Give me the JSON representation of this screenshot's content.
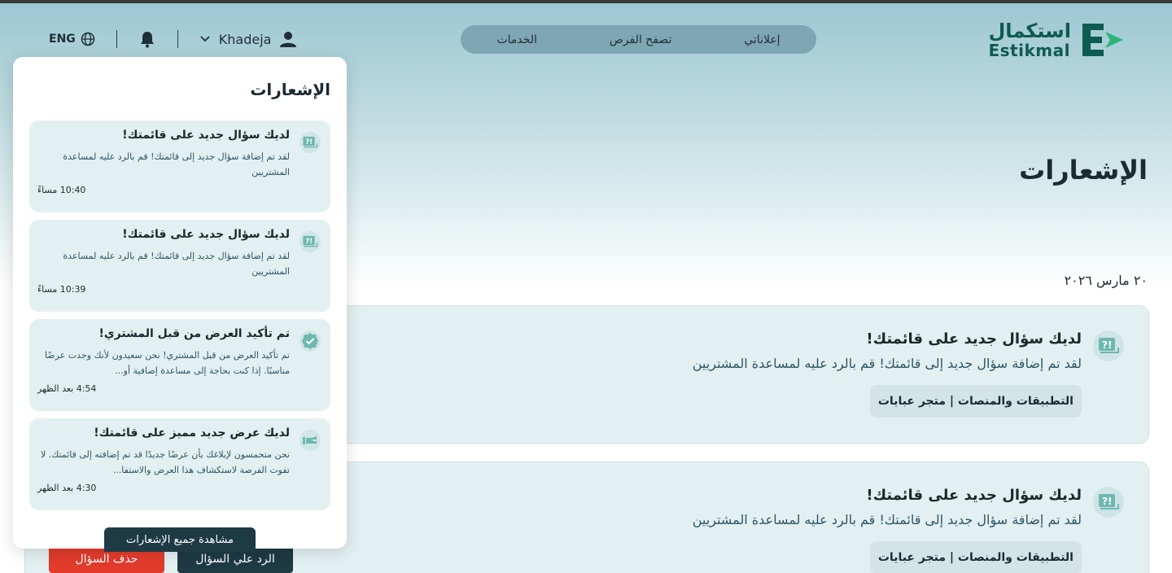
{
  "header": {
    "logo_ar": "استكمال",
    "logo_en": "Estikmal",
    "nav": [
      "إعلاناتي",
      "تصفح الفرص",
      "الخدمات"
    ],
    "lang": "ENG",
    "user_name": "Khadeja"
  },
  "page": {
    "title": "الإشعارات",
    "date": "٢٠ مارس ٢٠٢٦"
  },
  "cards": [
    {
      "title": "لديك سؤال جديد على قائمتك!",
      "desc": "لقد تم إضافة سؤال جديد إلى قائمتك! قم بالرد عليه لمساعدة المشتريين",
      "tag": "التطبيقات والمنصات | متجر عبايات"
    },
    {
      "title": "لديك سؤال جديد على قائمتك!",
      "desc": "لقد تم إضافة سؤال جديد إلى قائمتك! قم بالرد عليه لمساعدة المشتريين",
      "tag": "التطبيقات والمنصات | متجر عبايات"
    }
  ],
  "actions": {
    "reply": "الرد علي السؤال",
    "delete": "حذف السؤال"
  },
  "panel": {
    "title": "الإشعارات",
    "items": [
      {
        "icon": "question-icon",
        "title": "لديك سؤال جديد على قائمتك!",
        "desc": "لقد تم إضافة سؤال جديد إلى قائمتك! قم بالرد عليه لمساعدة المشتريين",
        "time": "10:40 مساءً"
      },
      {
        "icon": "question-icon",
        "title": "لديك سؤال جديد على قائمتك!",
        "desc": "لقد تم إضافة سؤال جديد إلى قائمتك! قم بالرد عليه لمساعدة المشتريين",
        "time": "10:39 مساءً"
      },
      {
        "icon": "verified-icon",
        "title": "تم تأكيد العرض من قبل المشتري!",
        "desc": "تم تأكيد العرض من قبل المشتري! نحن سعيدون لأنك وجدت عرضًا مناسبًا. إذا كنت بحاجة إلى مساعدة إضافية أو...",
        "time": "4:54 بعد الظهر"
      },
      {
        "icon": "offer-icon",
        "title": "لديك عرض جديد مميز على قائمتك!",
        "desc": "نحن متحمسون لإبلاغك بأن عرضًا جديدًا قد تم إضافته إلى قائمتك. لا تفوت الفرصة لاستكشاف هذا العرض والاستفا...",
        "time": "4:30 بعد الظهر"
      }
    ],
    "view_all": "مشاهدة جميع الإشعارات"
  },
  "colors": {
    "brand": "#0e5b52",
    "dark": "#1e3a45",
    "danger": "#e23b2c",
    "card_bg": "#e3f0f1"
  }
}
